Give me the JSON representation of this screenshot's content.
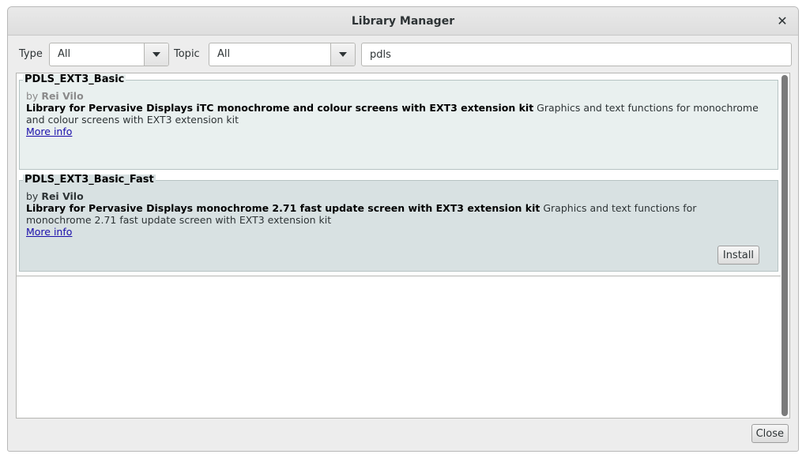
{
  "window": {
    "title": "Library Manager",
    "close_glyph": "✕"
  },
  "filters": {
    "type_label": "Type",
    "type_value": "All",
    "topic_label": "Topic",
    "topic_value": "All",
    "search_value": "pdls"
  },
  "libraries": [
    {
      "name": "PDLS_EXT3_Basic",
      "by_prefix": "by",
      "author": "Rei Vilo",
      "title": "Library for Pervasive Displays iTC monochrome and colour screens with EXT3 extension kit",
      "description": "Graphics and text functions for monochrome and colour screens with EXT3 extension kit",
      "more_info": "More info",
      "background": "#e9f0ef"
    },
    {
      "name": "PDLS_EXT3_Basic_Fast",
      "by_prefix": "by",
      "author": "Rei Vilo",
      "title": "Library for Pervasive Displays monochrome 2.71 fast update screen with EXT3 extension kit",
      "description": "Graphics and text functions for monochrome 2.71 fast update screen with EXT3 extension kit",
      "more_info": "More info",
      "install_label": "Install",
      "background": "#d8e1e2"
    }
  ],
  "footer": {
    "close_label": "Close"
  },
  "colors": {
    "link": "#1a0dab",
    "window_bg": "#ededed"
  },
  "icons": {
    "dropdown": "chevron-down-icon",
    "close": "close-icon"
  }
}
